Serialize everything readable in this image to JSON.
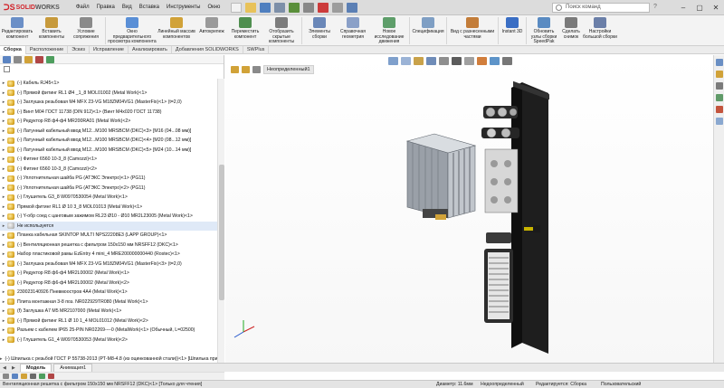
{
  "app": {
    "logo_mark": "ᑐS",
    "logo_text_1": "SOLID",
    "logo_text_2": "WORKS"
  },
  "menu": [
    "Файл",
    "Правка",
    "Вид",
    "Вставка",
    "Инструменты",
    "Окно"
  ],
  "search": {
    "placeholder": "Поиск команд"
  },
  "ribbon": [
    {
      "label": "Редактировать компонент",
      "color": "#6b8fc7"
    },
    {
      "label": "Вставить компоненты",
      "color": "#c79a3c"
    },
    {
      "label": "Условие сопряжения",
      "color": "#8a8a8a"
    },
    {
      "label": "Окно предварительного просмотра компонента",
      "color": "#5a8fd6"
    },
    {
      "label": "Линейный массив компонентов",
      "color": "#d1a238"
    },
    {
      "label": "Автокрепеж",
      "color": "#9a9a9a"
    },
    {
      "label": "Переместить компонент",
      "color": "#4f8f4f"
    },
    {
      "label": "Отобразить скрытые компоненты",
      "color": "#7c7c7c"
    },
    {
      "label": "Элементы сборки",
      "color": "#6a87b8"
    },
    {
      "label": "Справочная геометрия",
      "color": "#8aa0c8"
    },
    {
      "label": "Новое исследование движения",
      "color": "#5e9e6a"
    },
    {
      "label": "Спецификация",
      "color": "#7f9fc4"
    },
    {
      "label": "Вид с разнесенными частями",
      "color": "#c37d3a"
    },
    {
      "label": "Instant 3D",
      "color": "#3a6ec4"
    },
    {
      "label": "Обновить узлы сборки SpeedPak",
      "color": "#5a8bc2"
    },
    {
      "label": "Сделать снимок",
      "color": "#7a7a7a"
    },
    {
      "label": "Настройки большой сборки",
      "color": "#6b7fa8"
    }
  ],
  "command_tabs": [
    "Сборка",
    "Расположение",
    "Эскиз",
    "Исправление",
    "Анализировать",
    "Добавления SOLIDWORKS",
    "SWPlus"
  ],
  "tree": [
    {
      "text": "(-) Кабель RJ45<1>",
      "icon": "gold",
      "exp": true
    },
    {
      "text": "(-) Прямой фитинг RL1 Ø4 _1_8 MOL01002 (Metal Work)<1>",
      "icon": "gold",
      "exp": true
    },
    {
      "text": "(-) Заглушка резьбовая M4 MFX 23-VG M18ZM04VG1 (MasterFix)<1> (t=2,0)",
      "icon": "gold",
      "exp": true
    },
    {
      "text": "(-) Винт M04 ГОСТ 11738 (DIN 912)<1> (Винт M4x020 ГОСТ 11738)",
      "icon": "gold",
      "exp": true
    },
    {
      "text": "(-) Редуктор R8 ф4-ф4 MR200RA01 (Metal Work)<2>",
      "icon": "gold",
      "exp": true
    },
    {
      "text": "(-) Латунный кабельный ввод M12...M100 MRSBCM (DKC)<3> [M16 (04...08 мм)]",
      "icon": "gold",
      "exp": true
    },
    {
      "text": "(-) Латунный кабельный ввод M12...M100 MRSBCM (DKC)<4> [M20 (08...12 мм)]",
      "icon": "gold",
      "exp": true
    },
    {
      "text": "(-) Латунный кабельный ввод M12...M100 MRSBCM (DKC)<5> [M24 (10...14 мм)]",
      "icon": "gold",
      "exp": true
    },
    {
      "text": "(-) Фитинг 6560 10-3_8 (Camozzi)<1>",
      "icon": "gold",
      "exp": true
    },
    {
      "text": "(-) Фитинг 6560 10-3_8 (Camozzi)<2>",
      "icon": "gold",
      "exp": true
    },
    {
      "text": "(-) Уплотнительная шайба PG (АТЭКС Электро)<1> (PG11)",
      "icon": "gold",
      "exp": true
    },
    {
      "text": "(-) Уплотнительная шайба PG (АТЭКС Электро)<2> (PG11)",
      "icon": "gold",
      "exp": true
    },
    {
      "text": "(-) Глушитель G3_8 W0970530054 (Metal Work)<1>",
      "icon": "gold",
      "exp": true
    },
    {
      "text": "Прямой фитинг RL1 Ø 10 3_8 MOL01013 (Metal Work)<1>",
      "icon": "gold",
      "exp": true
    },
    {
      "text": "(-) Y-обр соед с цанговым зажимом RL23 Ø10 - Ø10 MR2L23005 (Metal Work)<1>",
      "icon": "gold",
      "exp": true
    },
    {
      "text": "Не используется",
      "icon": "grey",
      "exp": true,
      "hl": true
    },
    {
      "text": "Планка кабельная SKINTOP MULTI NPS22208E3 (LAPP GROUP)<1>",
      "icon": "gold",
      "exp": true
    },
    {
      "text": "(-) Вентиляционная решетка с фильтром 150х150 мм NRSFF12 (DKC)<1>",
      "icon": "gold",
      "exp": true
    },
    {
      "text": "Набор пластиковой рамы EzEntry 4 mini_4 MRE200000000440 (Rostec)<1>",
      "icon": "gold",
      "exp": true
    },
    {
      "text": "(-) Заглушка резьбовая M4 MFX 23-VG M18ZM04VG1 (MasterFix)<3> (t=2,0)",
      "icon": "gold",
      "exp": true
    },
    {
      "text": "(-) Редуктор R8 ф6-ф4 MR2L00002 (Metal Work)<1>",
      "icon": "gold",
      "exp": true
    },
    {
      "text": "(-) Редуктор R8 ф6-ф4 MR2L00002 (Metal Work)<2>",
      "icon": "gold",
      "exp": true
    },
    {
      "text": "230023140926 Пневмоостров 4A4 (Metal Work)<1>",
      "icon": "gold",
      "exp": true
    },
    {
      "text": "Плита монтажная 3-8 поз. NR022929TR080 (Metal Work)<1>",
      "icon": "gold",
      "exp": true
    },
    {
      "text": "(f) Заглушка A7 M5 MR2107000 (Metal Work)<1>",
      "icon": "gold",
      "exp": true
    },
    {
      "text": "(-) Прямой фитинг RL1 Ø 10 1_4 MOL01012 (Metal Work)<2>",
      "icon": "gold",
      "exp": true
    },
    {
      "text": "Разъем с кабелем IP65 25-PIN NR02269----0 (MetalWork)<1> (Обычный, L=02500)",
      "icon": "gold",
      "exp": true
    },
    {
      "text": "(-) Глушитель G1_4 W0970530053 (Metal Work)<2>",
      "icon": "gold",
      "exp": true
    },
    {
      "text": "",
      "icon": "none",
      "exp": false
    },
    {
      "text": "(-) Шпилька с резьбой ГОСТ Р 55738-2013 (РТ-М8-4.8 (из оцинкованной стали))<1> [Шпилька прист",
      "icon": "gold",
      "exp": true
    },
    {
      "text": "(-) Редуктор R8 ф6-ф4 MR2L00002 (Metal Work)<3>",
      "icon": "gold",
      "exp": true
    },
    {
      "text": "(-) Редуктор R8 ф6-ф4 MR2L00002 (Metal Work)<4>",
      "icon": "gold",
      "exp": true
    }
  ],
  "breadcrumb": {
    "label": "Неопределенный1"
  },
  "bottom_tabs": [
    "Модель",
    "Анимация1"
  ],
  "status": {
    "left": "Вентиляционная решетка с фильтром 150х150 мм NRSFF12 (DKC)<1> [Только для чтения]",
    "mid1": "Диаметр: 11.6мм",
    "mid2": "Недоопределенный",
    "mid3": "Редактируется: Сборка",
    "right": "Пользовательский"
  }
}
